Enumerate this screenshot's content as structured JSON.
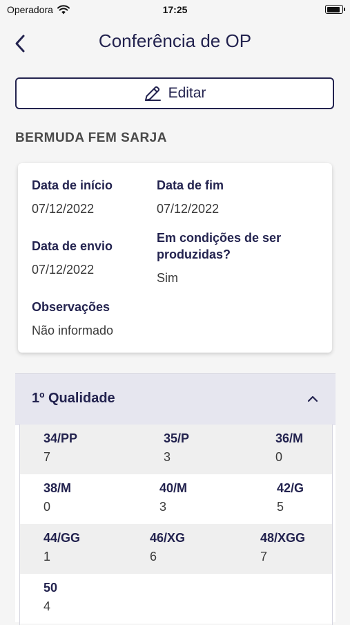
{
  "status_bar": {
    "carrier": "Operadora",
    "time": "17:25",
    "battery_level": 0.95
  },
  "nav": {
    "title": "Conferência de OP",
    "back_icon": "chevron-left-icon"
  },
  "edit_button": {
    "label": "Editar",
    "icon": "pencil-icon"
  },
  "product": {
    "name": "BERMUDA FEM SARJA"
  },
  "info": {
    "start_date_label": "Data de início",
    "start_date_value": "07/12/2022",
    "end_date_label": "Data de fim",
    "end_date_value": "07/12/2022",
    "send_date_label": "Data de envio",
    "send_date_value": "07/12/2022",
    "condition_label": "Em condições de ser produzidas?",
    "condition_value": "Sim",
    "notes_label": "Observações",
    "notes_value": "Não informado"
  },
  "quality": {
    "title": "1º Qualidade",
    "expanded": true,
    "sizes": [
      {
        "label": "34/PP",
        "qty": "7"
      },
      {
        "label": "35/P",
        "qty": "3"
      },
      {
        "label": "36/M",
        "qty": "0"
      },
      {
        "label": "38/M",
        "qty": "0"
      },
      {
        "label": "40/M",
        "qty": "3"
      },
      {
        "label": "42/G",
        "qty": "5"
      },
      {
        "label": "44/GG",
        "qty": "1"
      },
      {
        "label": "46/XG",
        "qty": "6"
      },
      {
        "label": "48/XGG",
        "qty": "7"
      },
      {
        "label": "50",
        "qty": "4"
      }
    ]
  },
  "colors": {
    "primary": "#23234f",
    "header_bg": "#e6e6ef",
    "row_shaded": "#efefef"
  }
}
